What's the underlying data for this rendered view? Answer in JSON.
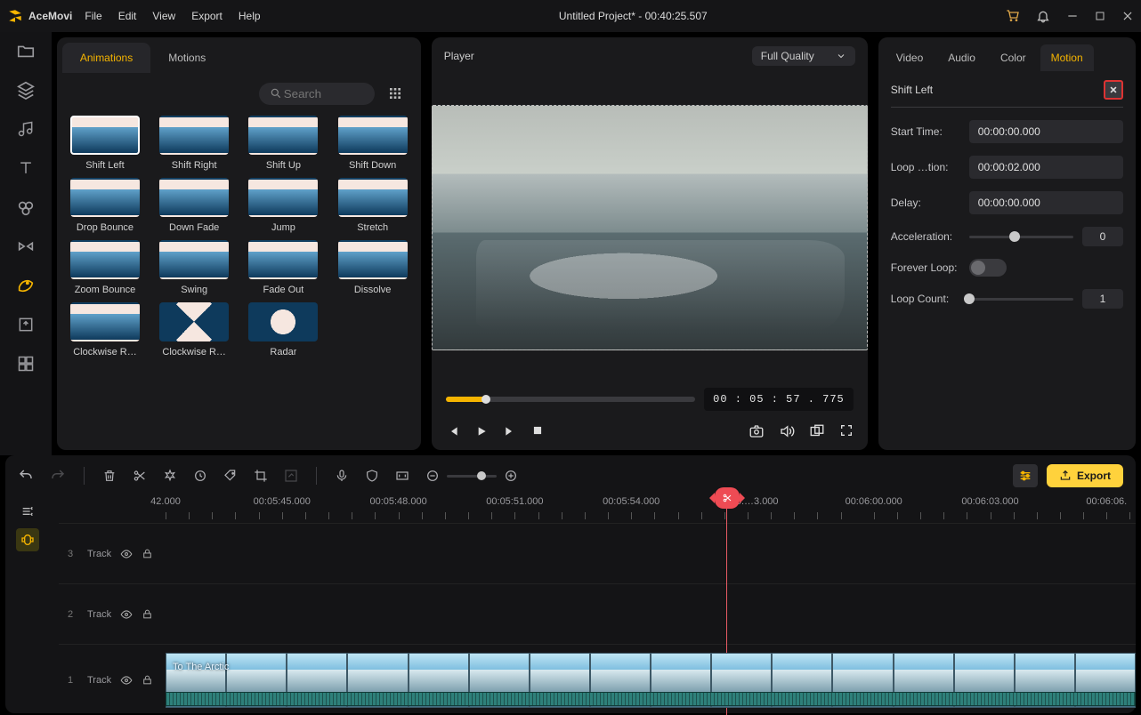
{
  "app": {
    "brand": "AceMovi",
    "title": "Untitled Project* - 00:40:25.507"
  },
  "menu": [
    "File",
    "Edit",
    "View",
    "Export",
    "Help"
  ],
  "browser": {
    "tabs": [
      {
        "label": "Animations",
        "active": true
      },
      {
        "label": "Motions",
        "active": false
      }
    ],
    "search_placeholder": "Search",
    "items": [
      {
        "label": "Shift Left",
        "selected": true
      },
      {
        "label": "Shift Right"
      },
      {
        "label": "Shift Up"
      },
      {
        "label": "Shift Down"
      },
      {
        "label": "Drop Bounce"
      },
      {
        "label": "Down Fade"
      },
      {
        "label": "Jump"
      },
      {
        "label": "Stretch"
      },
      {
        "label": "Zoom Bounce"
      },
      {
        "label": "Swing"
      },
      {
        "label": "Fade Out"
      },
      {
        "label": "Dissolve"
      },
      {
        "label": "Clockwise R…"
      },
      {
        "label": "Clockwise R…",
        "variant": "diag"
      },
      {
        "label": "Radar",
        "variant": "radar"
      }
    ]
  },
  "player": {
    "title": "Player",
    "quality": "Full Quality",
    "timecode": "00 : 05 : 57 . 775",
    "progress_pct": 16
  },
  "inspector": {
    "tabs": [
      {
        "label": "Video"
      },
      {
        "label": "Audio"
      },
      {
        "label": "Color"
      },
      {
        "label": "Motion",
        "active": true
      }
    ],
    "heading": "Shift Left",
    "start_time": {
      "label": "Start Time:",
      "value": "00:00:00.000"
    },
    "loop_tion": {
      "label": "Loop …tion:",
      "value": "00:00:02.000"
    },
    "delay": {
      "label": "Delay:",
      "value": "00:00:00.000"
    },
    "acceleration": {
      "label": "Acceleration:",
      "value": "0",
      "pct": 44
    },
    "forever": {
      "label": "Forever Loop:",
      "on": false
    },
    "loop_count": {
      "label": "Loop Count:",
      "value": "1",
      "pct": 0
    }
  },
  "timeline": {
    "export_label": "Export",
    "ruler": [
      {
        "pct": 0,
        "label": "42.000"
      },
      {
        "pct": 12,
        "label": "00:05:45.000"
      },
      {
        "pct": 24,
        "label": "00:05:48.000"
      },
      {
        "pct": 36,
        "label": "00:05:51.000"
      },
      {
        "pct": 48,
        "label": "00:05:54.000"
      },
      {
        "pct": 60,
        "label": "00:05:…3.000"
      },
      {
        "pct": 73,
        "label": "00:06:00.000"
      },
      {
        "pct": 85,
        "label": "00:06:03.000"
      },
      {
        "pct": 97,
        "label": "00:06:06."
      }
    ],
    "playhead_pct": 62,
    "tracks": [
      {
        "num": "3",
        "label": "Track",
        "empty": true
      },
      {
        "num": "2",
        "label": "Track",
        "empty": true
      },
      {
        "num": "1",
        "label": "Track",
        "clip": "To The Arctic"
      }
    ]
  }
}
